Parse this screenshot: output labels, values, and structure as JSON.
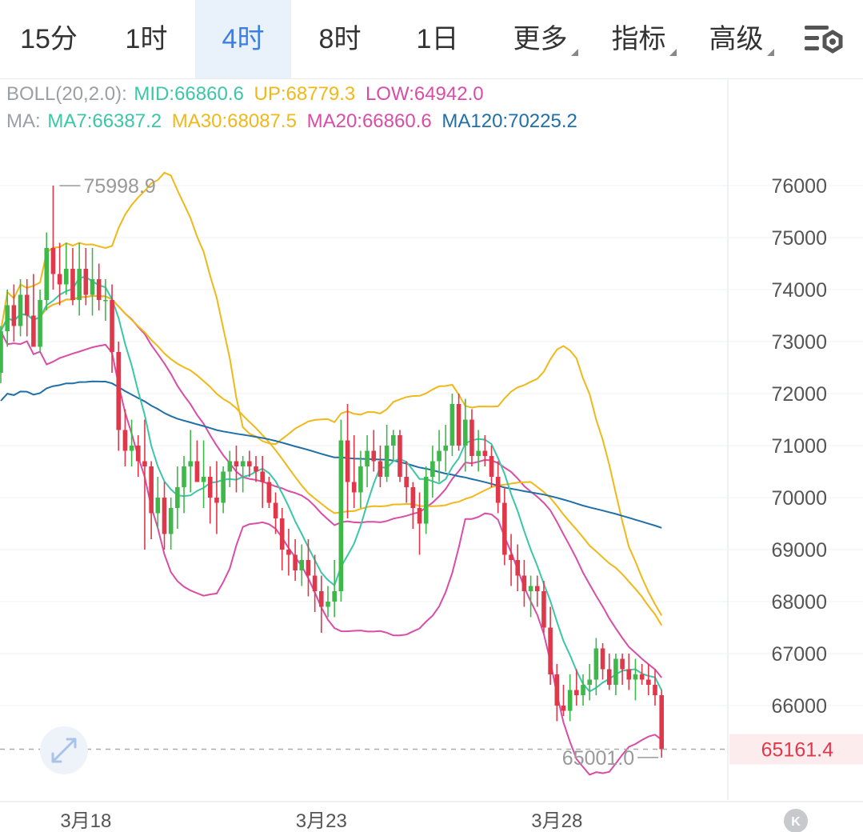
{
  "tabs": [
    {
      "label": "15分",
      "active": false,
      "dropdown": false
    },
    {
      "label": "1时",
      "active": false,
      "dropdown": false
    },
    {
      "label": "4时",
      "active": true,
      "dropdown": false
    },
    {
      "label": "8时",
      "active": false,
      "dropdown": false
    },
    {
      "label": "1日",
      "active": false,
      "dropdown": false
    },
    {
      "label": "更多",
      "active": false,
      "dropdown": true
    },
    {
      "label": "指标",
      "active": false,
      "dropdown": true
    },
    {
      "label": "高级",
      "active": false,
      "dropdown": true
    }
  ],
  "settings_icon": "chart-settings-icon",
  "legend": {
    "boll": {
      "label": "BOLL(20,2.0):",
      "mid": "MID:66860.6",
      "up": "UP:68779.3",
      "low": "LOW:64942.0"
    },
    "ma": {
      "label": "MA:",
      "ma7": "MA7:66387.2",
      "ma30": "MA30:68087.5",
      "ma20": "MA20:66860.6",
      "ma120": "MA120:70225.2"
    }
  },
  "colors": {
    "up": "#3fb84a",
    "down": "#e0384b",
    "mid": "#3cc6a8",
    "boll": "#f0b818",
    "ma20": "#d94da6",
    "ma120": "#1f6fa8",
    "grid": "#eef1f4",
    "axis": "#555555"
  },
  "chart_data": {
    "type": "candlestick",
    "y_ticks": [
      "76000",
      "75000",
      "74000",
      "73000",
      "72000",
      "71000",
      "70000",
      "69000",
      "68000",
      "67000",
      "66000"
    ],
    "ylim": [
      64500,
      77000
    ],
    "x_labels": [
      {
        "label": "3月18",
        "index": 13
      },
      {
        "label": "3月23",
        "index": 49
      },
      {
        "label": "3月28",
        "index": 85
      }
    ],
    "high_label": {
      "text": "75998.9",
      "value": 75998.9,
      "index": 8
    },
    "low_label": {
      "text": "65001.0",
      "value": 65001.0,
      "index": 101
    },
    "last_price": {
      "text": "65161.4",
      "value": 65161.4
    },
    "candles": [
      [
        72400,
        73300,
        72200,
        73200
      ],
      [
        73200,
        74000,
        72900,
        73700
      ],
      [
        73700,
        74100,
        73000,
        73300
      ],
      [
        73300,
        74200,
        73100,
        73900
      ],
      [
        73900,
        74200,
        73100,
        73500
      ],
      [
        73500,
        74300,
        73000,
        72900
      ],
      [
        72900,
        74000,
        72800,
        73800
      ],
      [
        73800,
        75100,
        73600,
        74800
      ],
      [
        74800,
        76000,
        74000,
        74300
      ],
      [
        74300,
        74900,
        73700,
        74100
      ],
      [
        74100,
        74900,
        73900,
        74400
      ],
      [
        74400,
        74800,
        73700,
        73800
      ],
      [
        73800,
        74900,
        73500,
        74400
      ],
      [
        74400,
        74800,
        73700,
        73900
      ],
      [
        73900,
        74800,
        73500,
        74200
      ],
      [
        74200,
        74500,
        73600,
        73800
      ],
      [
        73800,
        74200,
        73400,
        73800
      ],
      [
        73800,
        74100,
        72400,
        72800
      ],
      [
        72800,
        73000,
        70900,
        71300
      ],
      [
        71300,
        71700,
        70600,
        70900
      ],
      [
        70900,
        71500,
        70600,
        71000
      ],
      [
        71000,
        71200,
        70400,
        70700
      ],
      [
        70700,
        71500,
        69000,
        70600
      ],
      [
        70600,
        70700,
        69200,
        69700
      ],
      [
        69700,
        70400,
        69400,
        70000
      ],
      [
        70000,
        70300,
        69000,
        69300
      ],
      [
        69300,
        70000,
        69000,
        69800
      ],
      [
        69800,
        70600,
        69400,
        70200
      ],
      [
        70200,
        70800,
        69700,
        70600
      ],
      [
        70600,
        71300,
        70100,
        70700
      ],
      [
        70700,
        71100,
        70300,
        70300
      ],
      [
        70300,
        71100,
        69800,
        70400
      ],
      [
        70400,
        70600,
        69500,
        70000
      ],
      [
        70000,
        70700,
        69300,
        69900
      ],
      [
        69900,
        70600,
        69700,
        70500
      ],
      [
        70500,
        70900,
        70200,
        70700
      ],
      [
        70700,
        71000,
        70100,
        70600
      ],
      [
        70600,
        70800,
        70100,
        70700
      ],
      [
        70700,
        70900,
        70400,
        70600
      ],
      [
        70600,
        70800,
        70300,
        70500
      ],
      [
        70500,
        70800,
        69800,
        70300
      ],
      [
        70300,
        70400,
        69800,
        69900
      ],
      [
        69900,
        70100,
        69300,
        69600
      ],
      [
        69600,
        69800,
        68600,
        69000
      ],
      [
        69000,
        69400,
        68500,
        68900
      ],
      [
        68900,
        69200,
        68400,
        68600
      ],
      [
        68600,
        69100,
        68300,
        68800
      ],
      [
        68800,
        69200,
        68100,
        68500
      ],
      [
        68500,
        68900,
        67800,
        68200
      ],
      [
        68200,
        68500,
        67400,
        67900
      ],
      [
        67900,
        68300,
        67700,
        68000
      ],
      [
        68000,
        68800,
        67700,
        68200
      ],
      [
        68200,
        71500,
        68000,
        71100
      ],
      [
        71100,
        71800,
        69600,
        70300
      ],
      [
        70300,
        71200,
        69800,
        70100
      ],
      [
        70100,
        70900,
        69800,
        70600
      ],
      [
        70600,
        71200,
        70200,
        70900
      ],
      [
        70900,
        71300,
        70500,
        70700
      ],
      [
        70700,
        71000,
        70200,
        70400
      ],
      [
        70400,
        71400,
        70300,
        71000
      ],
      [
        71000,
        71300,
        70700,
        71200
      ],
      [
        71200,
        71300,
        70300,
        70400
      ],
      [
        70400,
        70700,
        69900,
        70200
      ],
      [
        70200,
        70300,
        69400,
        69800
      ],
      [
        69800,
        70100,
        68900,
        69500
      ],
      [
        69500,
        70600,
        69300,
        70400
      ],
      [
        70400,
        71000,
        70000,
        70700
      ],
      [
        70700,
        71300,
        70300,
        70900
      ],
      [
        70900,
        71400,
        70500,
        71000
      ],
      [
        71000,
        72000,
        70800,
        71800
      ],
      [
        71800,
        72000,
        70900,
        71000
      ],
      [
        71000,
        71900,
        70500,
        71500
      ],
      [
        71500,
        71700,
        70600,
        70800
      ],
      [
        70800,
        71300,
        70500,
        70900
      ],
      [
        70900,
        71200,
        70600,
        70800
      ],
      [
        70800,
        71000,
        70200,
        70400
      ],
      [
        70400,
        70700,
        69700,
        69900
      ],
      [
        69900,
        70200,
        68700,
        68900
      ],
      [
        68900,
        69300,
        68300,
        68800
      ],
      [
        68800,
        69100,
        68200,
        68500
      ],
      [
        68500,
        68800,
        67900,
        68200
      ],
      [
        68200,
        68500,
        67700,
        68300
      ],
      [
        68300,
        68500,
        67900,
        68200
      ],
      [
        68200,
        68400,
        67400,
        67500
      ],
      [
        67500,
        67900,
        66400,
        66600
      ],
      [
        66600,
        66800,
        65700,
        66000
      ],
      [
        66000,
        66400,
        65800,
        65900
      ],
      [
        65900,
        66600,
        65700,
        66300
      ],
      [
        66300,
        66700,
        66000,
        66200
      ],
      [
        66200,
        66600,
        66000,
        66400
      ],
      [
        66400,
        66800,
        66100,
        66500
      ],
      [
        66500,
        67300,
        66200,
        67100
      ],
      [
        67100,
        67200,
        66500,
        66700
      ],
      [
        66700,
        67000,
        66300,
        66400
      ],
      [
        66400,
        67000,
        66200,
        66900
      ],
      [
        66900,
        67000,
        66400,
        66700
      ],
      [
        66700,
        67000,
        66300,
        66500
      ],
      [
        66500,
        66900,
        66100,
        66600
      ],
      [
        66600,
        66800,
        66400,
        66500
      ],
      [
        66500,
        66800,
        66200,
        66400
      ],
      [
        66400,
        66700,
        66000,
        66200
      ],
      [
        66200,
        66300,
        65000,
        65161.4
      ]
    ]
  }
}
